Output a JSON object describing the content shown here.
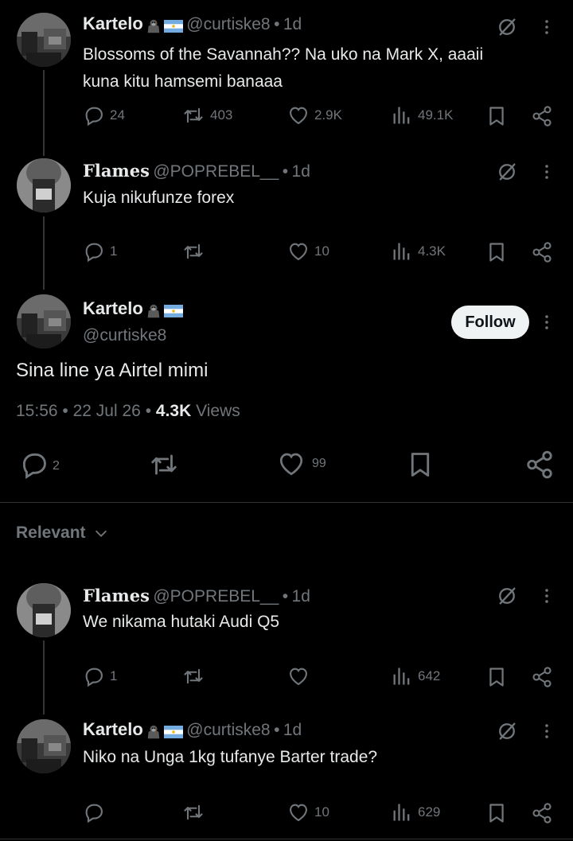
{
  "posts": [
    {
      "name": "Kartelo",
      "handle": "@curtiske8",
      "time": "1d",
      "text_lines": [
        "Blossoms of the Savannah?? Na uko na Mark X, aaaii",
        "kuna kitu hamsemi banaaa"
      ],
      "replies": "24",
      "reposts": "403",
      "likes": "2.9K",
      "views": "49.1K"
    },
    {
      "name": "Flames",
      "handle": "@POPREBEL__",
      "time": "1d",
      "text_lines": [
        "Kuja nikufunze forex"
      ],
      "replies": "1",
      "reposts": "",
      "likes": "10",
      "views": "4.3K"
    }
  ],
  "main": {
    "name": "Kartelo",
    "handle": "@curtiske8",
    "follow_label": "Follow",
    "text": "Sina line ya Airtel mimi",
    "timestamp": "15:56",
    "date": "22 Jul 26",
    "views_count": "4.3K",
    "views_label": "Views",
    "replies": "2",
    "likes": "99"
  },
  "relevant_label": "Relevant",
  "replies": [
    {
      "name": "Flames",
      "handle": "@POPREBEL__",
      "time": "1d",
      "text": "We nikama hutaki Audi Q5",
      "replies": "1",
      "likes": "",
      "views": "642"
    },
    {
      "name": "Kartelo",
      "handle": "@curtiske8",
      "time": "1d",
      "text": "Niko na Unga 1kg tufanye Barter trade?",
      "replies": "",
      "likes": "10",
      "views": "629"
    }
  ],
  "dot": "•",
  "icons": [
    "reply-icon",
    "repost-icon",
    "like-icon",
    "views-icon",
    "bookmark-icon",
    "share-icon",
    "grok-icon",
    "more-icon",
    "chevron-down-icon",
    "flag-argentina",
    "gorilla-emoji"
  ],
  "colors": {
    "background": "#000000",
    "text": "#e7e9ea",
    "muted": "#71767b",
    "divider": "#2f3336"
  }
}
